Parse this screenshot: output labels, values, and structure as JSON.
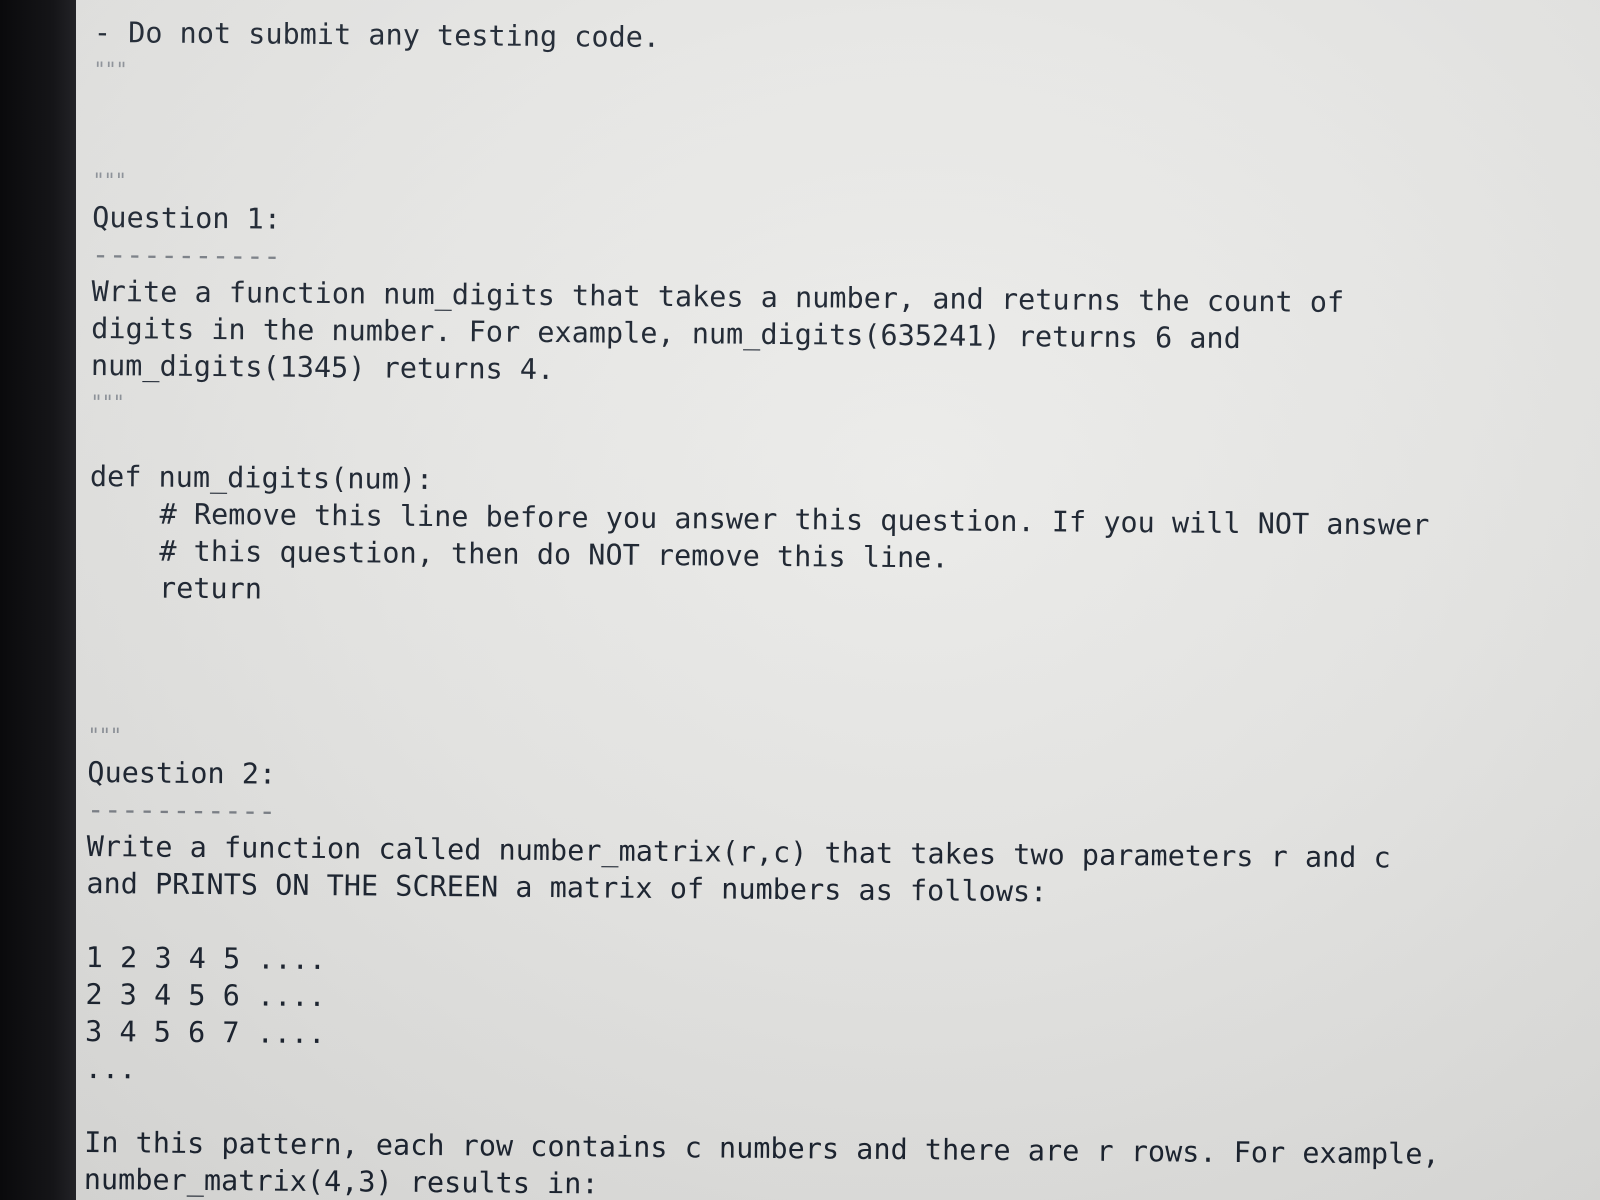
{
  "code": {
    "line_01": "- Do not submit any testing code.",
    "line_02": "\"\"\"",
    "line_03": "\"\"\"",
    "line_04": "Question 1:",
    "line_05": "-----------",
    "line_06": "Write a function num_digits that takes a number, and returns the count of",
    "line_07": "digits in the number. For example, num_digits(635241) returns 6 and",
    "line_08": "num_digits(1345) returns 4.",
    "line_09": "\"\"\"",
    "line_10": "def num_digits(num):",
    "line_11": "# Remove this line before you answer this question. If you will NOT answer",
    "line_12": "# this question, then do NOT remove this line.",
    "line_13": "return",
    "line_14": "\"\"\"",
    "line_15": "Question 2:",
    "line_16": "-----------",
    "line_17": "Write a function called number_matrix(r,c) that takes two parameters r and c",
    "line_18": "and PRINTS ON THE SCREEN a matrix of numbers as follows:",
    "line_19": "1 2 3 4 5 ....",
    "line_20": "2 3 4 5 6 ....",
    "line_21": "3 4 5 6 7 ....",
    "line_22": "...",
    "line_23": "In this pattern, each row contains c numbers and there are r rows. For example,",
    "line_24": "number_matrix(4,3) results in:"
  }
}
